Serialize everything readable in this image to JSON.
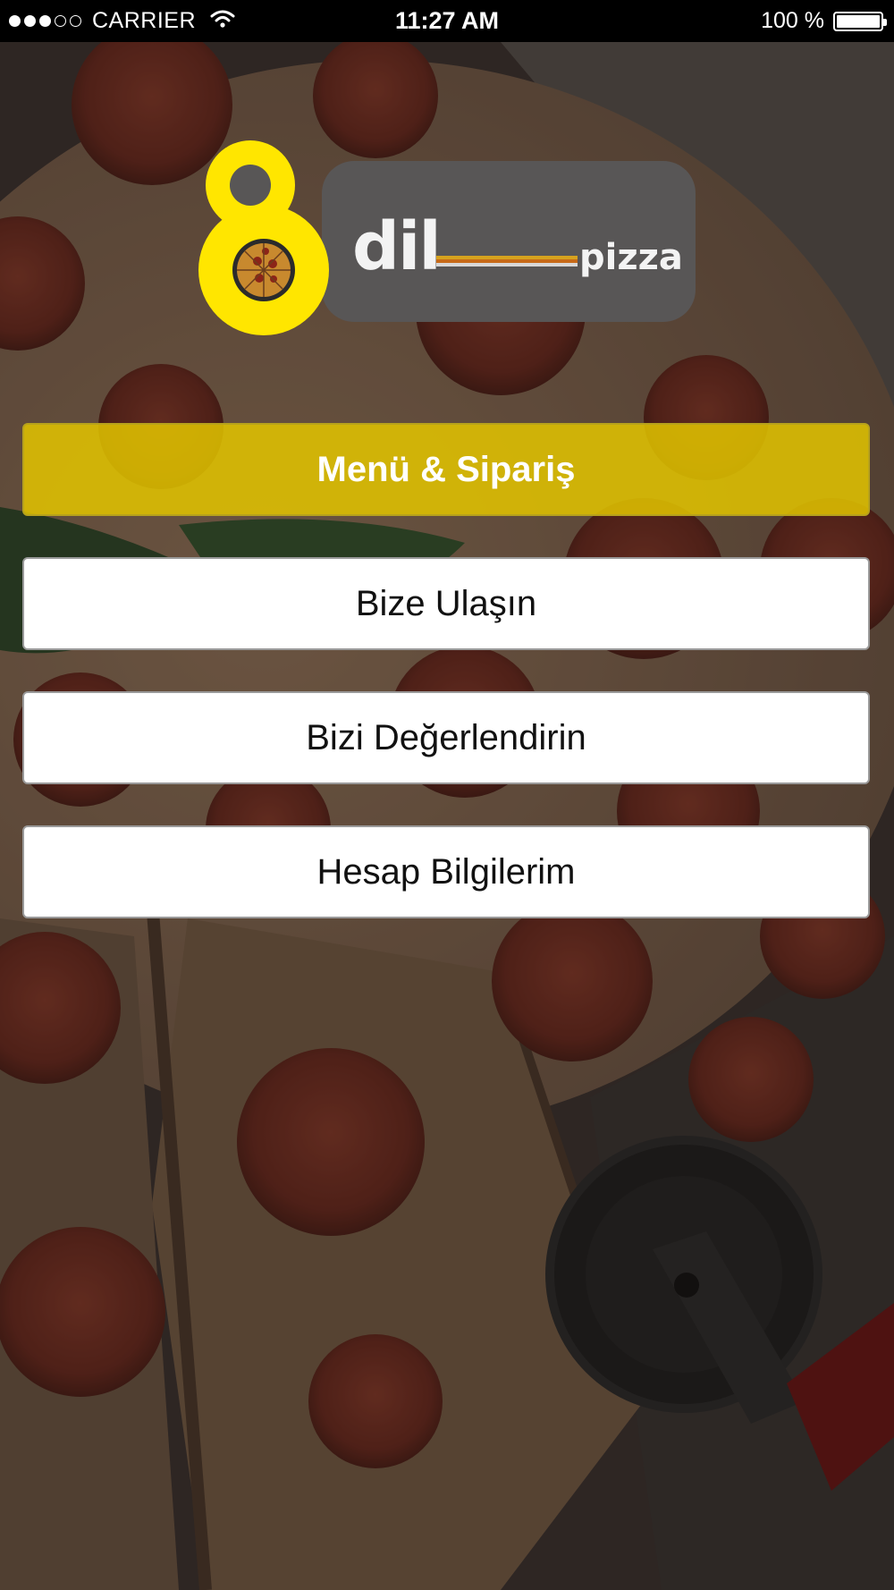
{
  "status_bar": {
    "carrier": "CARRIER",
    "time": "11:27 AM",
    "battery": "100 %",
    "battery_level": 1.0,
    "signal_bars_filled": 3,
    "signal_bars_total": 5
  },
  "logo": {
    "digit": "8",
    "word_main": "dil",
    "word_secondary": "pizza",
    "colors": {
      "yellow": "#ffe600",
      "panel": "#585656",
      "stripe_1": "#d6a21e",
      "stripe_2": "#c76a18",
      "stripe_3": "#d8d8d8"
    }
  },
  "buttons": {
    "menu_order": "Menü & Sipariş",
    "contact": "Bize Ulaşın",
    "rate": "Bizi Değerlendirin",
    "account": "Hesap Bilgilerim"
  },
  "colors": {
    "accent": "#e2c400",
    "button_bg": "#ffffff",
    "button_text": "#111111"
  },
  "background": {
    "icon": "pizza-photo"
  }
}
